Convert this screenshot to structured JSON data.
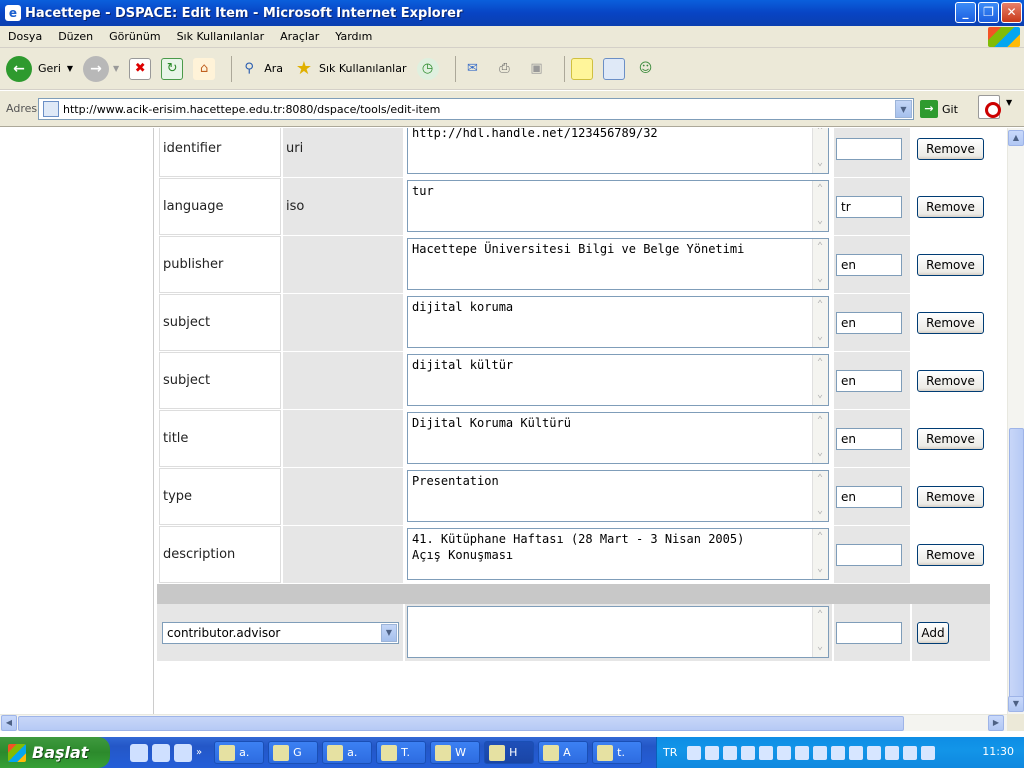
{
  "window": {
    "title": "Hacettepe - DSPACE: Edit Item - Microsoft Internet Explorer",
    "min_label": "_",
    "max_label": "❐",
    "close_label": "✕"
  },
  "menu": [
    "Dosya",
    "Düzen",
    "Görünüm",
    "Sık Kullanılanlar",
    "Araçlar",
    "Yardım"
  ],
  "toolbar": {
    "back_label": "Geri",
    "search_label": "Ara",
    "favorites_label": "Sık Kullanılanlar"
  },
  "address": {
    "label": "Adres",
    "url": "http://www.acik-erisim.hacettepe.edu.tr:8080/dspace/tools/edit-item",
    "go_label": "Git"
  },
  "metadata_rows": [
    {
      "element": "identifier",
      "qualifier": "uri",
      "value": "http://hdl.handle.net/123456789/32",
      "lang": "",
      "button": "Remove"
    },
    {
      "element": "language",
      "qualifier": "iso",
      "value": "tur",
      "lang": "tr",
      "button": "Remove"
    },
    {
      "element": "publisher",
      "qualifier": "",
      "value": "Hacettepe Üniversitesi Bilgi ve Belge Yönetimi",
      "lang": "en",
      "button": "Remove"
    },
    {
      "element": "subject",
      "qualifier": "",
      "value": "dijital koruma",
      "lang": "en",
      "button": "Remove"
    },
    {
      "element": "subject",
      "qualifier": "",
      "value": "dijital kültür",
      "lang": "en",
      "button": "Remove"
    },
    {
      "element": "title",
      "qualifier": "",
      "value": "Dijital Koruma Kültürü",
      "lang": "en",
      "button": "Remove"
    },
    {
      "element": "type",
      "qualifier": "",
      "value": "Presentation",
      "lang": "en",
      "button": "Remove"
    },
    {
      "element": "description",
      "qualifier": "",
      "value": "41. Kütüphane Haftası (28 Mart - 3 Nisan 2005)\nAçış Konuşması",
      "lang": "",
      "button": "Remove"
    }
  ],
  "add_row": {
    "field_select": "contributor.advisor",
    "value": "",
    "lang": "",
    "button": "Add"
  },
  "taskbar": {
    "start_label": "Başlat",
    "tasks": [
      "a.",
      "G",
      "a.",
      "T.",
      "W",
      "H",
      "A",
      "t."
    ],
    "lang": "TR",
    "clock": "11:30"
  }
}
